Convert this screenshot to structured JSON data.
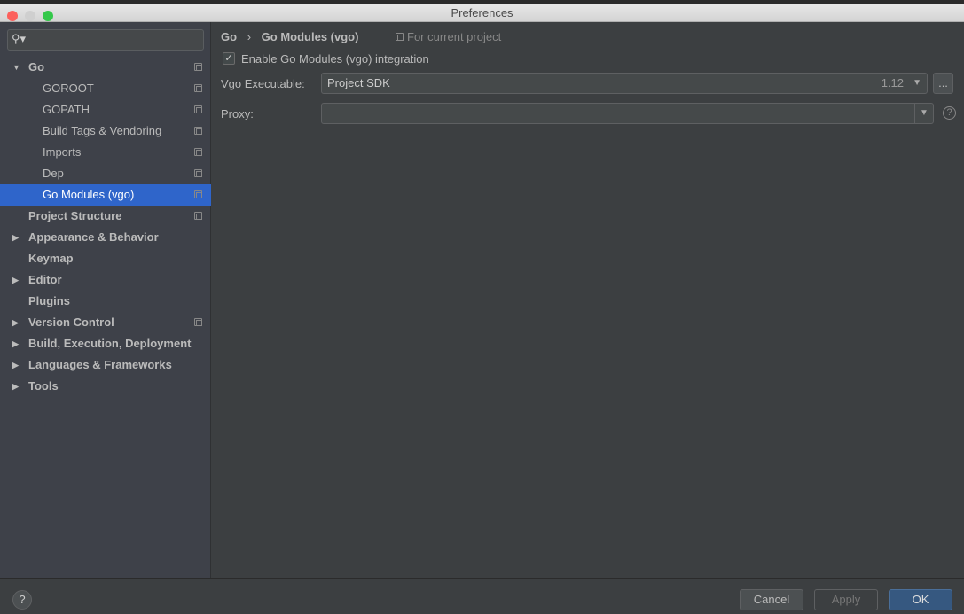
{
  "window": {
    "title": "Preferences"
  },
  "search": {
    "placeholder": ""
  },
  "sidebar": {
    "items": [
      {
        "label": "Go",
        "expanded": true,
        "bold": true,
        "project": true
      },
      {
        "label": "GOROOT",
        "project": true
      },
      {
        "label": "GOPATH",
        "project": true
      },
      {
        "label": "Build Tags & Vendoring",
        "project": true
      },
      {
        "label": "Imports",
        "project": true
      },
      {
        "label": "Dep",
        "project": true
      },
      {
        "label": "Go Modules (vgo)",
        "project": true,
        "selected": true
      },
      {
        "label": "Project Structure",
        "bold": true,
        "project": true
      },
      {
        "label": "Appearance & Behavior",
        "bold": true,
        "collapsed": true
      },
      {
        "label": "Keymap",
        "bold": true
      },
      {
        "label": "Editor",
        "bold": true,
        "collapsed": true
      },
      {
        "label": "Plugins",
        "bold": true
      },
      {
        "label": "Version Control",
        "bold": true,
        "collapsed": true,
        "project": true
      },
      {
        "label": "Build, Execution, Deployment",
        "bold": true,
        "collapsed": true
      },
      {
        "label": "Languages & Frameworks",
        "bold": true,
        "collapsed": true
      },
      {
        "label": "Tools",
        "bold": true,
        "collapsed": true
      }
    ]
  },
  "breadcrumb": {
    "parent": "Go",
    "separator": "›",
    "current": "Go Modules (vgo)",
    "scope": "For current project"
  },
  "form": {
    "enable_label": "Enable Go Modules (vgo) integration",
    "enable_checked": true,
    "vgo_label": "Vgo Executable:",
    "vgo_value": "Project SDK",
    "vgo_version": "1.12",
    "browse": "...",
    "proxy_label": "Proxy:",
    "proxy_value": ""
  },
  "footer": {
    "help": "?",
    "cancel": "Cancel",
    "apply": "Apply",
    "ok": "OK"
  },
  "colors": {
    "accent": "#2f65ca",
    "ok_button": "#365880"
  }
}
